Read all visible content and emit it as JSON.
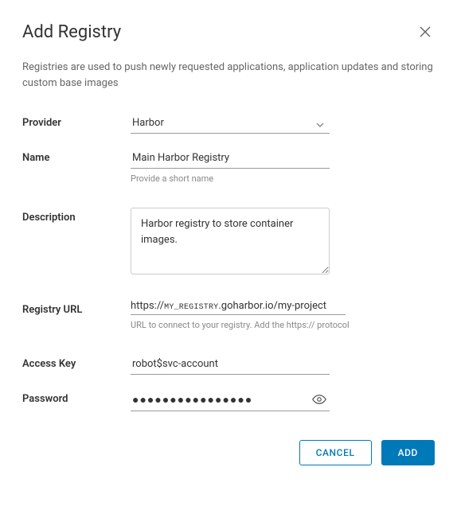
{
  "header": {
    "title": "Add Registry"
  },
  "intro": "Registries are used to push newly requested applications, application updates and storing custom base images",
  "form": {
    "provider": {
      "label": "Provider",
      "value": "Harbor"
    },
    "name": {
      "label": "Name",
      "value": "Main Harbor Registry",
      "help": "Provide a short name"
    },
    "description": {
      "label": "Description",
      "value": "Harbor registry to store container images."
    },
    "registry_url": {
      "label": "Registry URL",
      "prefix": "https://",
      "host": "MY_REGISTRY",
      "suffix": ".goharbor.io/my-project",
      "help": "URL to connect to your registry. Add the https:// protocol"
    },
    "access_key": {
      "label": "Access Key",
      "value": "robot$svc-account"
    },
    "password": {
      "label": "Password",
      "masked": "●●●●●●●●●●●●●●●●"
    }
  },
  "footer": {
    "cancel": "CANCEL",
    "add": "ADD"
  }
}
